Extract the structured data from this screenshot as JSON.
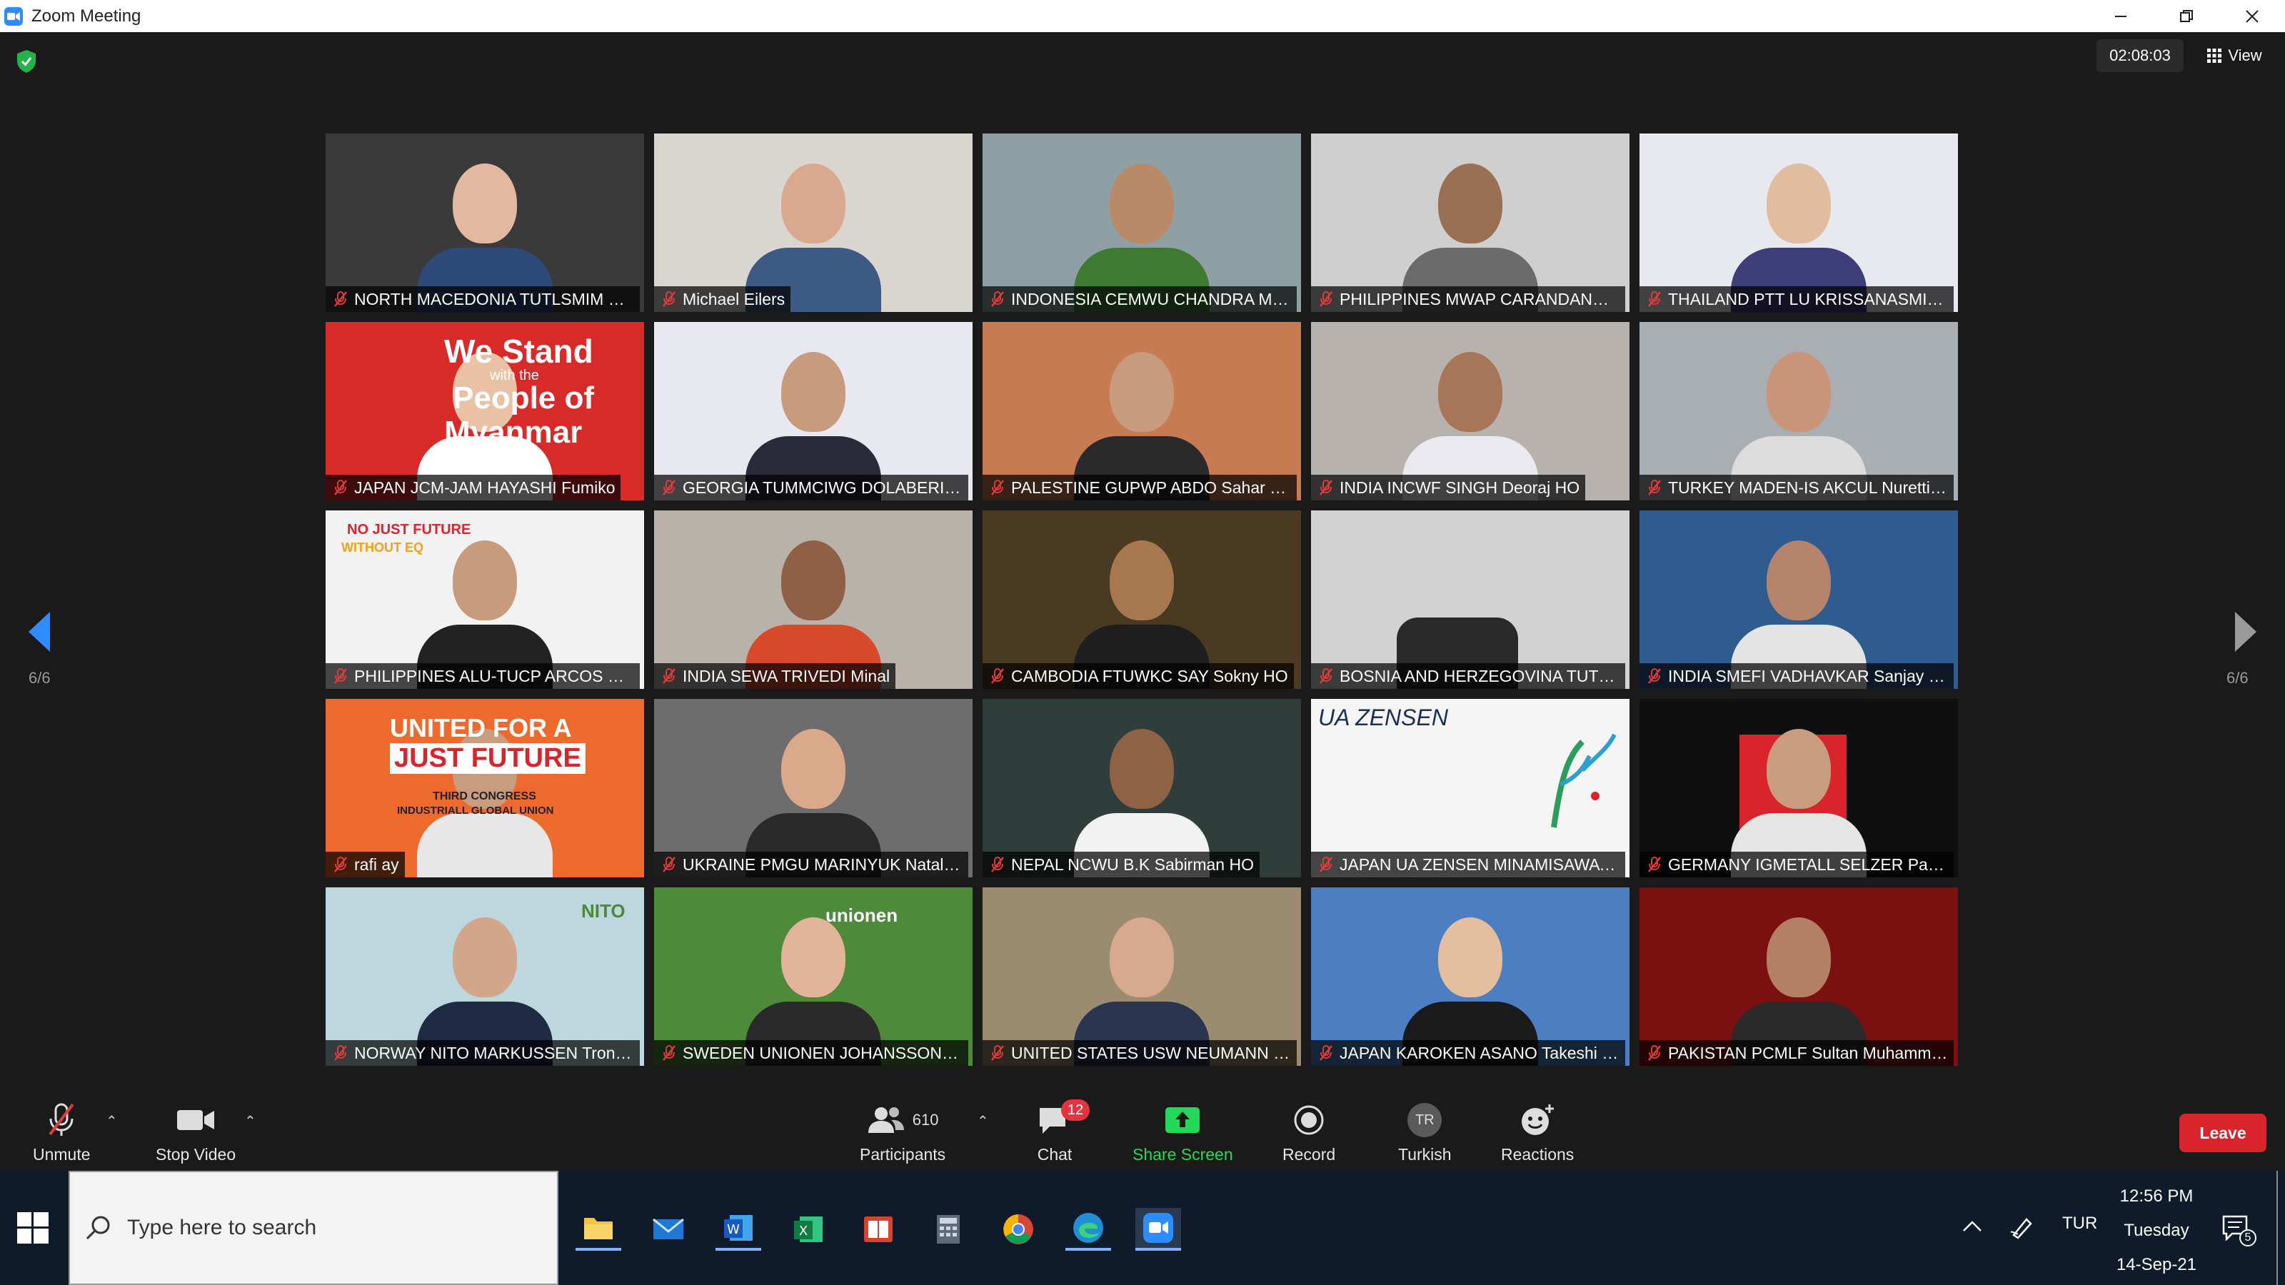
{
  "window": {
    "title": "Zoom Meeting"
  },
  "meeting": {
    "timer": "02:08:03",
    "view_label": "View",
    "page_indicator_left": "6/6",
    "page_indicator_right": "6/6"
  },
  "participants": [
    {
      "name": "NORTH MACEDONIA TUTLSMIM RA...",
      "bg": "#3b3a3a",
      "skin": "#e2b9a0",
      "shirt": "#2d4a7a"
    },
    {
      "name": "Michael Eilers",
      "bg": "#d9d6cf",
      "skin": "#d8a98e",
      "shirt": "#3d5a85"
    },
    {
      "name": "INDONESIA CEMWU CHANDRA Ma...",
      "bg": "#8fa0a5",
      "skin": "#b88a68",
      "shirt": "#3f7a33"
    },
    {
      "name": "PHILIPPINES MWAP CARANDANG J...",
      "bg": "#cfcfcf",
      "skin": "#9a7054",
      "shirt": "#6b6b6b"
    },
    {
      "name": "THAILAND PTT LU KRISSANASMIT ...",
      "bg": "#e8e8ef",
      "skin": "#e0bca0",
      "shirt": "#3d3d7a"
    },
    {
      "name": "JAPAN JCM-JAM HAYASHI Fumiko",
      "bg": "#d92a2a",
      "skin": "#e9c2a5",
      "shirt": "#ffffff"
    },
    {
      "name": "GEORGIA TUMMCIWG DOLABERIDZ...",
      "bg": "#e8e8f0",
      "skin": "#c89b7d",
      "shirt": "#2a2a3a"
    },
    {
      "name": "PALESTINE GUPWP ABDO Sahar HO",
      "bg": "#c77b52",
      "skin": "#c89b7d",
      "shirt": "#2a2a2a"
    },
    {
      "name": "INDIA INCWF SINGH Deoraj HO",
      "bg": "#b7b2ad",
      "skin": "#a77557",
      "shirt": "#e9e9ef"
    },
    {
      "name": "TURKEY MADEN-IS AKCUL Nurettin ...",
      "bg": "#a9aeb3",
      "skin": "#c99478",
      "shirt": "#dcdcdc"
    },
    {
      "name": "PHILIPPINES ALU-TUCP ARCOS Eva ...",
      "bg": "#f2f2f2",
      "skin": "#c89b7d",
      "shirt": "#222222"
    },
    {
      "name": "INDIA SEWA TRIVEDI Minal",
      "bg": "#b8b2ab",
      "skin": "#8f6045",
      "shirt": "#d84a2a"
    },
    {
      "name": "CAMBODIA FTUWKC SAY Sokny HO",
      "bg": "#4b3a22",
      "skin": "#a7774f",
      "shirt": "#1e1e1e"
    },
    {
      "name": "BOSNIA AND HERZEGOVINA TUTLSI...",
      "bg": "#d2d2d2",
      "skin": "#d2d2d2",
      "shirt": "#2a2a2a"
    },
    {
      "name": "INDIA SMEFI VADHAVKAR Sanjay HO",
      "bg": "#2f5c8f",
      "skin": "#b5836b",
      "shirt": "#e4e4e4"
    },
    {
      "name": "rafi ay",
      "bg": "#ee6a2c",
      "skin": "#c99c80",
      "shirt": "#e7e7e7"
    },
    {
      "name": "UKRAINE PMGU MARINYUK Natal Ya",
      "bg": "#6d6d6d",
      "skin": "#d9a98a",
      "shirt": "#2a2a2a"
    },
    {
      "name": "NEPAL NCWU B.K Sabirman HO",
      "bg": "#2f3e3a",
      "skin": "#8e6245",
      "shirt": "#f2f2f2"
    },
    {
      "name": "JAPAN UA ZENSEN MINAMISAWA H...",
      "bg": "#f5f5f5",
      "skin": "#f5f5f5",
      "shirt": "#f5f5f5"
    },
    {
      "name": "GERMANY IGMETALL SELZER Patrick",
      "bg": "#0f0f0f",
      "skin": "#c99c80",
      "shirt": "#e5e5e5"
    },
    {
      "name": "NORWAY NITO MARKUSSEN Trond ...",
      "bg": "#bcd7de",
      "skin": "#d3a58a",
      "shirt": "#1f2a44"
    },
    {
      "name": "SWEDEN UNIONEN JOHANSSON Ul...",
      "bg": "#4d8a3a",
      "skin": "#e2b49a",
      "shirt": "#2a2a2a"
    },
    {
      "name": "UNITED STATES USW NEUMANN Ken",
      "bg": "#9b8b70",
      "skin": "#d7a98e",
      "shirt": "#2a3550"
    },
    {
      "name": "JAPAN KAROKEN ASANO Takeshi HO",
      "bg": "#4d7ec2",
      "skin": "#e3bf9f",
      "shirt": "#1a1a1a"
    },
    {
      "name": "PAKISTAN PCMLF Sultan Muhamma...",
      "bg": "#7a1010",
      "skin": "#b48065",
      "shirt": "#2a2a2a"
    }
  ],
  "tile_texts": {
    "japan_banner_line1": "We Stand",
    "japan_banner_line2": "with the",
    "japan_banner_line3": "People of",
    "japan_banner_line4": "Myanmar",
    "philippines_banner": "NO JUST FUTURE",
    "philippines_banner2": "WITHOUT EQ",
    "rafi_banner1": "UNITED FOR A",
    "rafi_banner2": "JUST FUTURE",
    "rafi_banner3": "THIRD CONGRESS",
    "rafi_banner4": "INDUSTRIALL GLOBAL UNION",
    "uazensen_logo": "UA ZENSEN",
    "nito_logo": "NITO",
    "unionen_logo": "unionen"
  },
  "toolbar": {
    "unmute": "Unmute",
    "stop_video": "Stop Video",
    "participants": "Participants",
    "participants_count": "610",
    "chat": "Chat",
    "chat_badge": "12",
    "share_screen": "Share Screen",
    "record": "Record",
    "turkish": "Turkish",
    "turkish_avatar": "TR",
    "reactions": "Reactions",
    "leave": "Leave"
  },
  "taskbar": {
    "search_placeholder": "Type here to search",
    "language": "TUR",
    "time": "12:56 PM",
    "day": "Tuesday",
    "date": "14-Sep-21",
    "notification_count": "5"
  },
  "colors": {
    "share_green": "#23d959",
    "leave_red": "#d9242c",
    "mic_red": "#e03a3a",
    "zoom_blue": "#2d8cff"
  }
}
